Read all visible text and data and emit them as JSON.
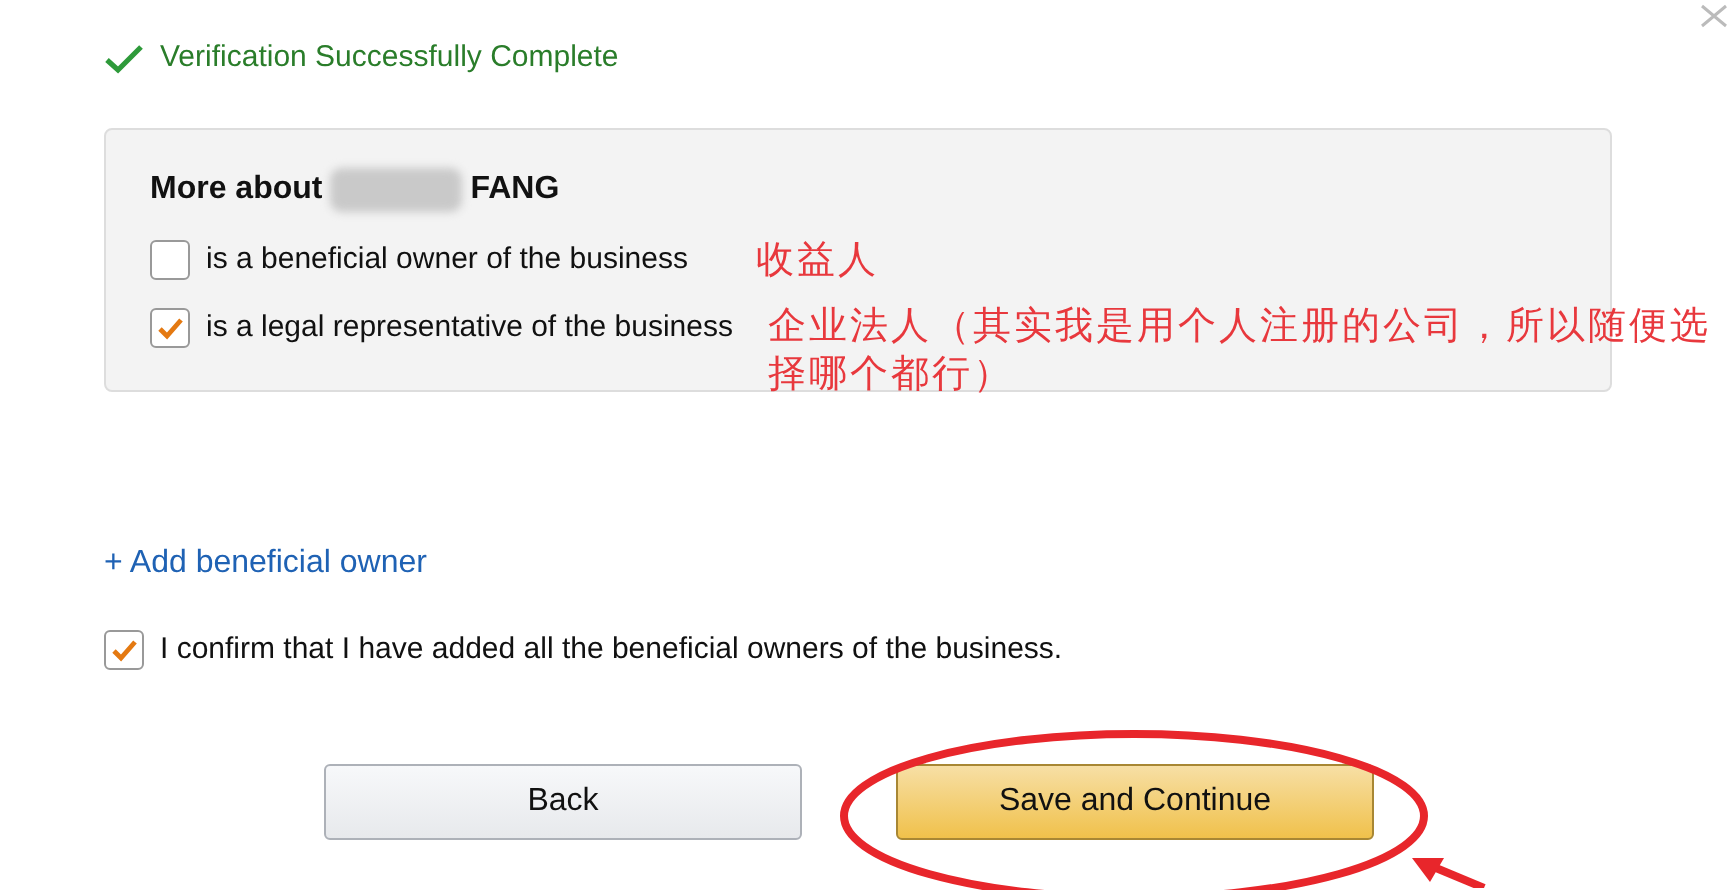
{
  "status": {
    "text": "Verification Successfully Complete"
  },
  "owner_panel": {
    "heading_start": "More about",
    "heading_end": "FANG",
    "name_redacted": true,
    "options": [
      {
        "label": "is a beneficial owner of the business",
        "checked": false
      },
      {
        "label": "is a legal representative of the business",
        "checked": true
      }
    ]
  },
  "add_link": "+ Add beneficial owner",
  "confirm": {
    "label": "I confirm that I have added all the beneficial owners of the business.",
    "checked": true
  },
  "buttons": [
    {
      "label": "Back",
      "kind": "secondary"
    },
    {
      "label": "Save and Continue",
      "kind": "primary"
    }
  ],
  "annotations": [
    {
      "kind": "note",
      "text": "收益人"
    },
    {
      "kind": "note",
      "text": "企业法人（其实我是用个人注册的公司，所以随便选择哪个都行）"
    },
    {
      "kind": "ellipse"
    },
    {
      "kind": "arrow"
    }
  ]
}
